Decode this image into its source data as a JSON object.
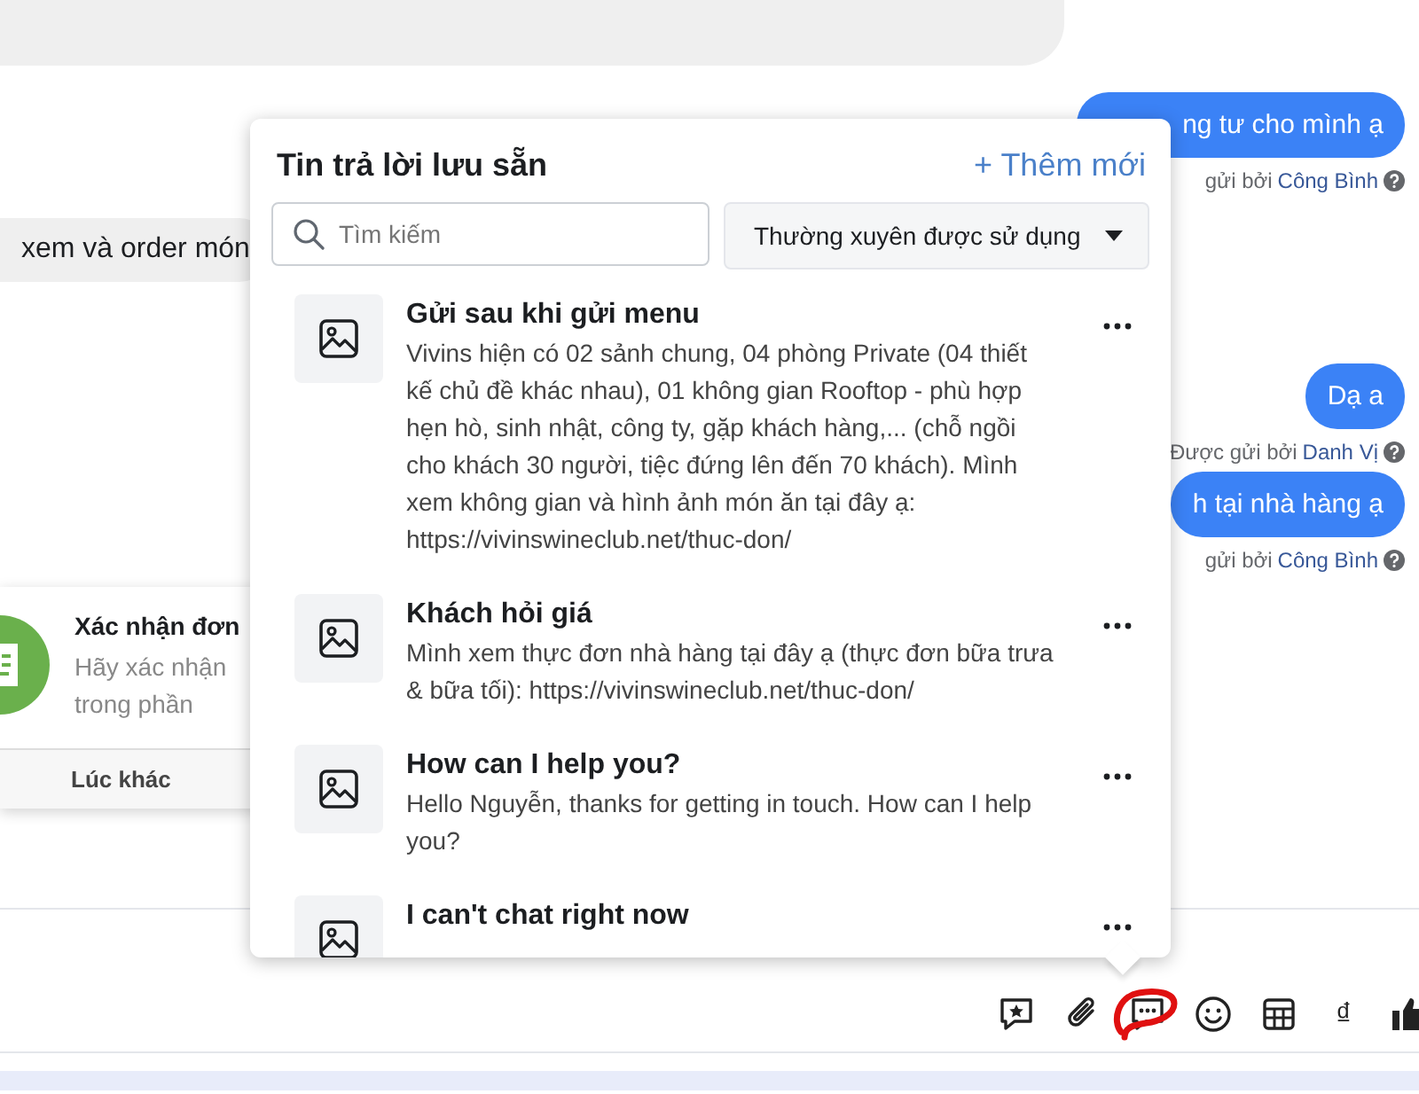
{
  "chat": {
    "messages": [
      {
        "kind": "sent",
        "text": "ng tư cho mình ạ",
        "sent_by_label": "gửi bởi",
        "sender": "Công Bình"
      },
      {
        "kind": "received",
        "text": "xem và order món"
      },
      {
        "kind": "sent",
        "text": "Dạ a",
        "sent_by_label": "Được gửi bởi",
        "sender": "Danh Vị"
      },
      {
        "kind": "sent",
        "text": "h tại nhà hàng ạ",
        "sent_by_label": "gửi bởi",
        "sender": "Công Bình"
      }
    ],
    "card": {
      "title": "Xác nhận đơn",
      "lines": [
        "Hãy xác nhận",
        "trong phần"
      ],
      "button": "Lúc khác"
    }
  },
  "saved_replies": {
    "title": "Tin trả lời lưu sẵn",
    "add_button": "+ Thêm mới",
    "search": {
      "placeholder": "Tìm kiếm"
    },
    "filter": {
      "value": "Thường xuyên được sử dụng"
    },
    "items": [
      {
        "title": "Gửi sau khi gửi menu",
        "body": "Vivins hiện có 02 sảnh chung, 04 phòng Private (04 thiết kế chủ đề khác nhau), 01 không gian Rooftop - phù hợp hẹn hò, sinh nhật, công ty, gặp khách hàng,... (chỗ ngồi cho khách 30 người, tiệc đứng lên đến 70 khách). Mình xem không gian và hình ảnh món ăn tại đây ạ: https://vivinswineclub.net/thuc-don/"
      },
      {
        "title": "Khách hỏi giá",
        "body": "Mình xem thực đơn nhà hàng tại đây ạ (thực đơn bữa trưa & bữa tối): https://vivinswineclub.net/thuc-don/"
      },
      {
        "title": "How can I help you?",
        "body": "Hello Nguyễn, thanks for getting in touch. How can I help you?"
      },
      {
        "title": "I can't chat right now"
      }
    ]
  },
  "toolbar": {
    "tools": [
      {
        "kind": "star-message",
        "selected": false
      },
      {
        "kind": "attach",
        "selected": false
      },
      {
        "kind": "saved-replies",
        "selected": true
      },
      {
        "kind": "emoji",
        "selected": false
      },
      {
        "kind": "table",
        "selected": false
      },
      {
        "kind": "currency",
        "glyph": "₫",
        "selected": false
      },
      {
        "kind": "like",
        "selected": false
      }
    ]
  }
}
